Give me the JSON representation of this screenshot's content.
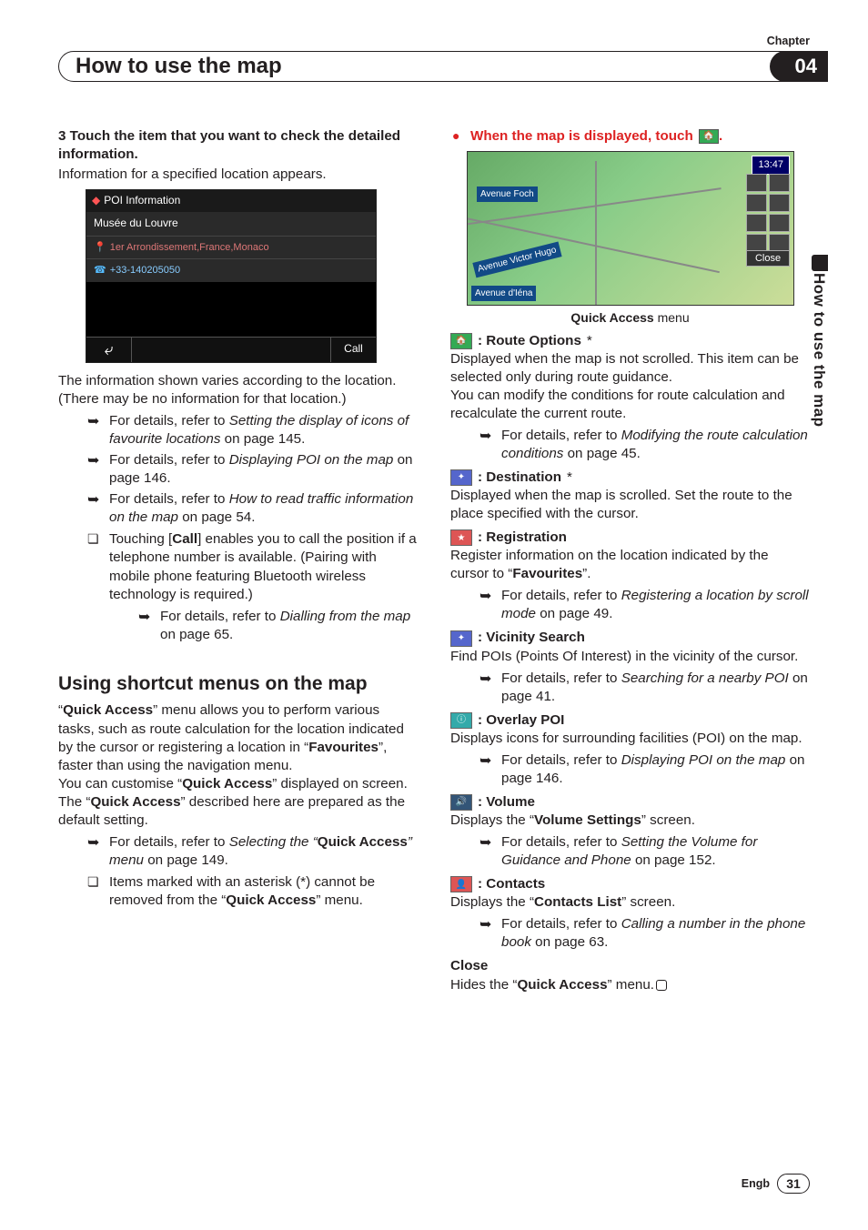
{
  "header": {
    "chapter_label": "Chapter",
    "chapter_number": "04",
    "title": "How to use the map"
  },
  "side": {
    "label": "How to use the map"
  },
  "left": {
    "step_head": "3   Touch the item that you want to check the detailed information.",
    "step_body": "Information for a specified location appears.",
    "fig": {
      "title": "POI Information",
      "name": "Musée du Louvre",
      "addr": "1er Arrondissement,France,Monaco",
      "phone": "+33-140205050",
      "back": "⤶",
      "call": "Call"
    },
    "p1": "The information shown varies according to the location. (There may be no information for that location.)",
    "refs": [
      "For details, refer to Setting the display of icons of favourite locations on page 145.",
      "For details, refer to Displaying POI on the map on page 146.",
      "For details, refer to How to read traffic information on the map on page 54."
    ],
    "note": {
      "text": "Touching [Call] enables you to call the position if a telephone number is available. (Pairing with mobile phone featuring Bluetooth wireless technology is required.)",
      "ref": "For details, refer to Dialling from the map on page 65."
    },
    "h2": "Using shortcut menus on the map",
    "p2a": "“Quick Access” menu allows you to perform various tasks, such as route calculation for the location indicated by the cursor or registering a location in “Favourites”, faster than using the navigation menu.",
    "p2b": "You can customise “Quick Access” displayed on screen. The “Quick Access” described here are prepared as the default setting.",
    "ref2": "For details, refer to Selecting the “Quick Access” menu on page 149.",
    "note2": "Items marked with an asterisk (*) cannot be removed from the “Quick Access” menu."
  },
  "right": {
    "bullet": "When the map is displayed, touch",
    "map": {
      "time": "13:47",
      "close": "Close",
      "s1": "Avenue Foch",
      "s2": "Avenue Victor Hugo",
      "s3": "Avenue d'Iéna"
    },
    "caption_b": "Quick Access",
    "caption_r": " menu",
    "items": [
      {
        "title": "Route Options",
        "star": "*",
        "desc": "Displayed when the map is not scrolled. This item can be selected only during route guidance.\nYou can modify the conditions for route calculation and recalculate the current route.",
        "ref": "For details, refer to Modifying the route calculation conditions on page 45."
      },
      {
        "title": "Destination",
        "star": "*",
        "desc": "Displayed when the map is scrolled. Set the route to the place specified with the cursor."
      },
      {
        "title": "Registration",
        "desc": "Register information on the location indicated by the cursor to “Favourites”.",
        "ref": "For details, refer to Registering a location by scroll mode on page 49."
      },
      {
        "title": "Vicinity Search",
        "desc": "Find POIs (Points Of Interest) in the vicinity of the cursor.",
        "ref": "For details, refer to Searching for a nearby POI on page 41."
      },
      {
        "title": "Overlay POI",
        "desc": "Displays icons for surrounding facilities (POI) on the map.",
        "ref": "For details, refer to Displaying POI on the map on page 146."
      },
      {
        "title": "Volume",
        "desc": "Displays the “Volume Settings” screen.",
        "ref": "For details, refer to Setting the Volume for Guidance and Phone on page 152."
      },
      {
        "title": "Contacts",
        "desc": "Displays the “Contacts List” screen.",
        "ref": "For details, refer to Calling a number in the phone book on page 63."
      }
    ],
    "close_t": "Close",
    "close_d": "Hides the “Quick Access” menu."
  },
  "footer": {
    "lang": "Engb",
    "page": "31"
  }
}
